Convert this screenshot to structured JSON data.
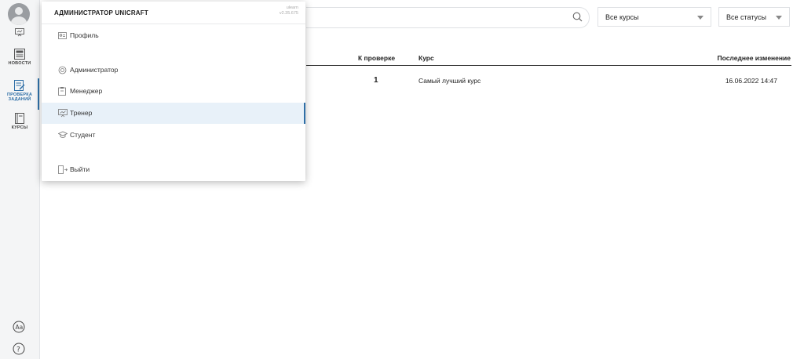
{
  "sidebar": {
    "items": [
      {
        "label": "НОВОСТИ"
      },
      {
        "label": "ПРОВЕРКА ЗАДАНИЙ"
      },
      {
        "label": "КУРСЫ"
      }
    ]
  },
  "filters": {
    "search_placeholder": "",
    "course_select": "Все курсы",
    "status_select": "Все статусы"
  },
  "table": {
    "columns": [
      "К проверке",
      "Курс",
      "Последнее изменение"
    ],
    "rows": [
      {
        "count": "1",
        "course": "Самый лучший курс",
        "changed": "16.06.2022 14:47"
      }
    ]
  },
  "menu": {
    "title": "АДМИНИСТРАТОР UNICRAFT",
    "app_name": "ulearn",
    "version": "v2.35.675",
    "items": [
      {
        "label": "Профиль",
        "icon": "profile-icon"
      },
      {
        "label": "Администратор",
        "icon": "gear-icon"
      },
      {
        "label": "Менеджер",
        "icon": "clipboard-icon"
      },
      {
        "label": "Тренер",
        "icon": "presentation-icon"
      },
      {
        "label": "Студент",
        "icon": "graduation-cap-icon"
      },
      {
        "label": "Выйти",
        "icon": "logout-icon"
      }
    ],
    "active_item": "Тренер"
  },
  "colors": {
    "accent": "#2f6fa7",
    "active_bg": "#e8f1f9"
  }
}
